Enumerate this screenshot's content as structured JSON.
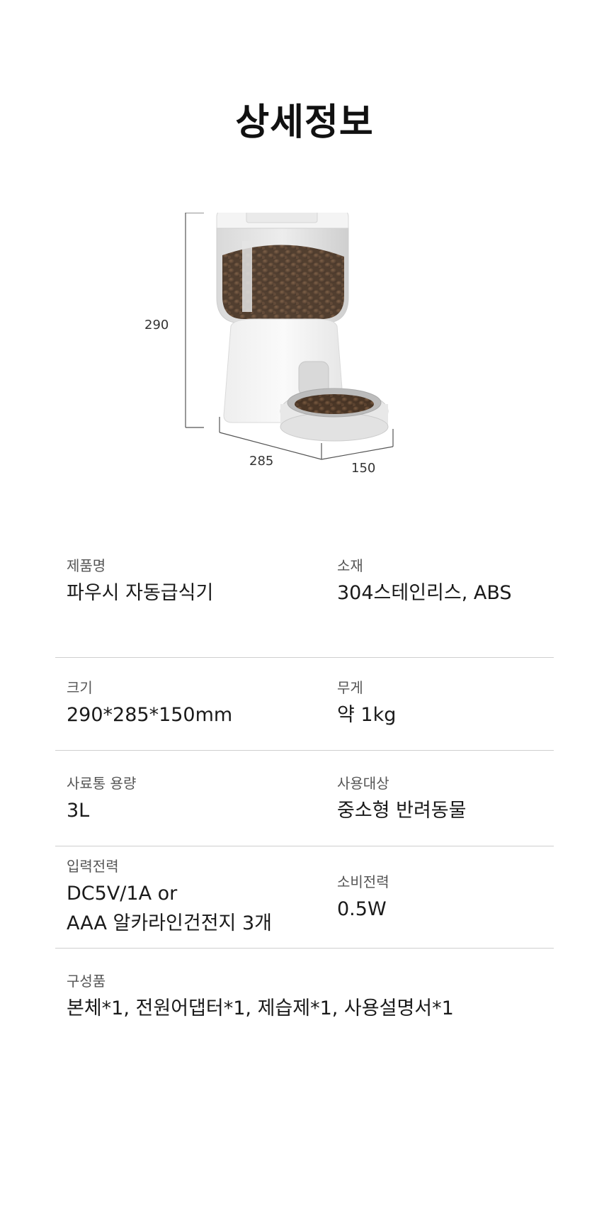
{
  "title": "상세정보",
  "figure": {
    "dim_height": "290",
    "dim_depth": "285",
    "dim_width": "150"
  },
  "specs": {
    "row1": {
      "left": {
        "label": "제품명",
        "value": "파우시 자동급식기"
      },
      "right": {
        "label": "소재",
        "value": "304스테인리스, ABS"
      }
    },
    "row2": {
      "left": {
        "label": "크기",
        "value": "290*285*150mm"
      },
      "right": {
        "label": "무게",
        "value": "약 1kg"
      }
    },
    "row3": {
      "left": {
        "label": "사료통 용량",
        "value": "3L"
      },
      "right": {
        "label": "사용대상",
        "value": "중소형 반려동물"
      }
    },
    "row4": {
      "left": {
        "label": "입력전력",
        "value_line1": "DC5V/1A or",
        "value_line2": "AAA 알카라인건전지 3개"
      },
      "right": {
        "label": "소비전력",
        "value": "0.5W"
      }
    },
    "row5": {
      "left": {
        "label": "구성품",
        "value": "본체*1, 전원어댑터*1, 제습제*1, 사용설명서*1"
      }
    }
  },
  "colors": {
    "divider": "#cfcfcf",
    "text": "#1a1a1a",
    "label": "#555555"
  }
}
